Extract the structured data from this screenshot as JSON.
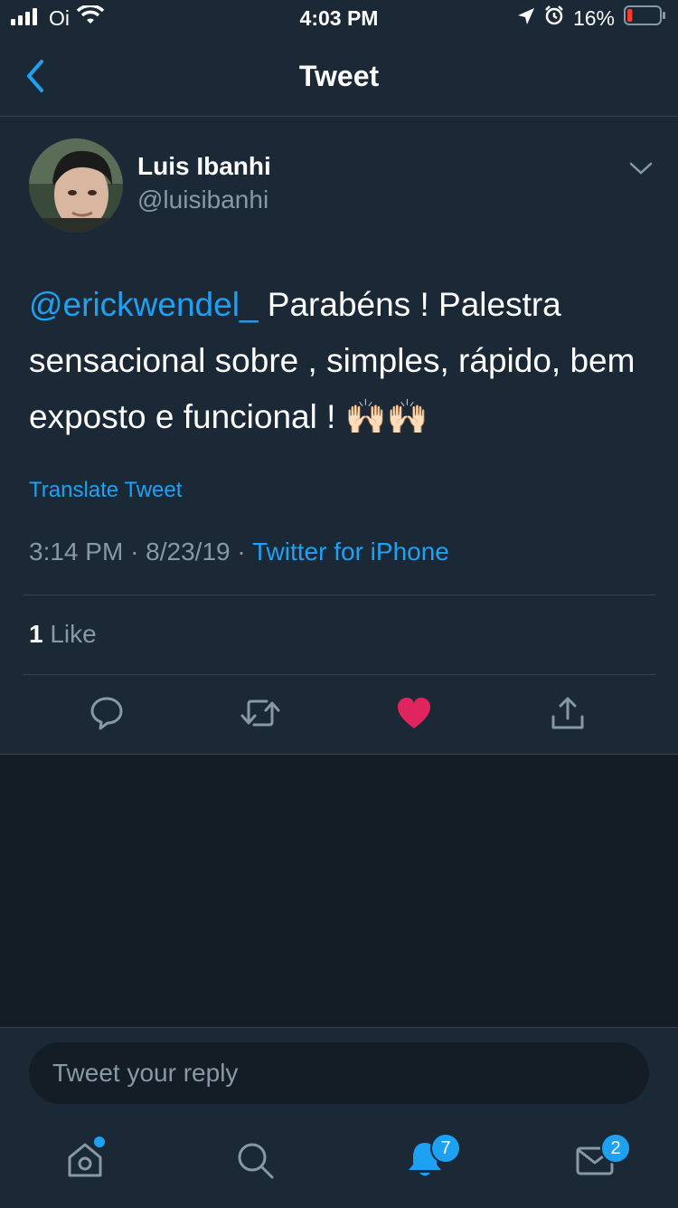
{
  "status_bar": {
    "carrier": "Oi",
    "time": "4:03 PM",
    "battery": "16%",
    "battery_level": 0.16
  },
  "header": {
    "title": "Tweet",
    "back_icon": "chevron-left-icon"
  },
  "tweet": {
    "author_name": "Luis Ibanhi",
    "author_handle": "@luisibanhi",
    "mention": "@erickwendel_",
    "text": " Parabéns ! Palestra sensacional sobre , simples, rápido, bem exposto e funcional ! ",
    "emoji": "🙌🏻🙌🏻",
    "translate_label": "Translate Tweet",
    "time": "3:14 PM",
    "date": "8/23/19",
    "separator": "·",
    "source": "Twitter for iPhone",
    "like_count": "1",
    "like_label": "Like",
    "liked": true
  },
  "actions": {
    "reply_icon": "reply-icon",
    "retweet_icon": "retweet-icon",
    "like_icon": "heart-icon",
    "share_icon": "share-icon"
  },
  "reply": {
    "placeholder": "Tweet your reply"
  },
  "tab_bar": {
    "home_icon": "home-icon",
    "search_icon": "search-icon",
    "notifications_icon": "bell-icon",
    "notifications_badge": "7",
    "messages_icon": "mail-icon",
    "messages_badge": "2"
  },
  "colors": {
    "accent": "#1da1f2",
    "like": "#e0245e",
    "background": "#141d26",
    "surface": "#1b2836",
    "muted": "#8899a6"
  }
}
